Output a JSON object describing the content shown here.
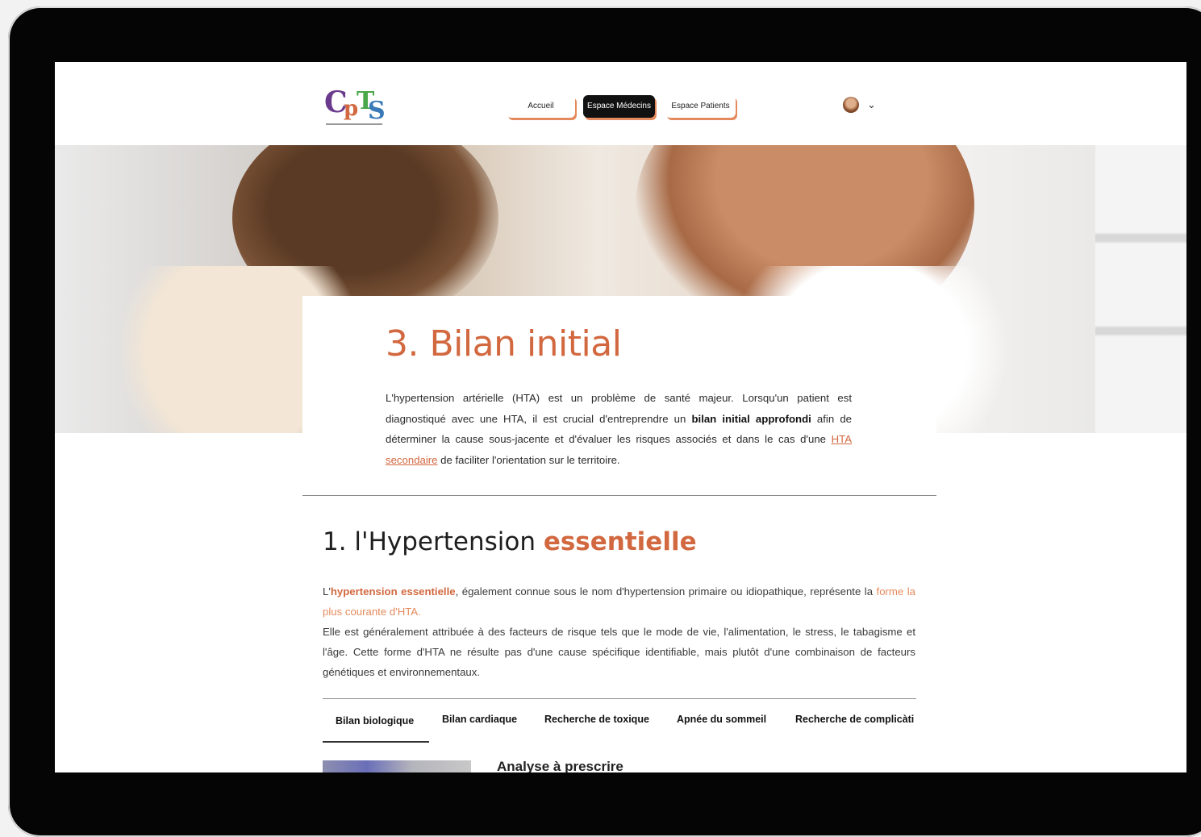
{
  "nav": {
    "items": [
      {
        "label": "Accueil"
      },
      {
        "label": "Espace Médecins"
      },
      {
        "label": "Espace Patients"
      }
    ],
    "active_index": 1
  },
  "logo": {
    "text": "CPTS"
  },
  "user_menu": {
    "icon": "chevron-down-icon"
  },
  "page": {
    "title": "3. Bilan initial",
    "intro": {
      "part1": "L'hypertension artérielle (HTA) est un problème de santé majeur. Lorsqu'un patient est diagnostiqué avec une HTA, il est crucial d'entreprendre un ",
      "bold": "bilan initial approfondi",
      "part2": " afin de déterminer la cause sous-jacente et d'évaluer les risques associés et dans le cas d'une ",
      "link": "HTA secondaire",
      "part3": " de faciliter l'orientation sur le territoire."
    }
  },
  "section": {
    "title_prefix": "1. l'Hypertension ",
    "title_accent": "essentielle",
    "p1_start": "L'",
    "p1_hl": "hypertension essentielle",
    "p1_rest": ", également connue sous le nom d'hypertension primaire ou idiopathique, représente la ",
    "p1_soft": "forme la plus courante d'HTA.",
    "p2": "Elle est généralement attribuée à des facteurs de risque tels que le mode de vie, l'alimentation, le stress, le tabagisme et l'âge. Cette forme d'HTA ne résulte pas d'une cause spécifique identifiable, mais plutôt d'une combinaison de facteurs génétiques et environnementaux."
  },
  "tabs": [
    {
      "label": "Bilan biologique"
    },
    {
      "label": "Bilan cardiaque"
    },
    {
      "label": "Recherche de toxique"
    },
    {
      "label": "Apnée du sommeil"
    },
    {
      "label": "Recherche de complicàti"
    }
  ],
  "active_tab": 0,
  "panel": {
    "title": "Analyse à prescrire"
  },
  "colors": {
    "accent": "#d2683f",
    "nav_shadow": "#e58a5c"
  }
}
